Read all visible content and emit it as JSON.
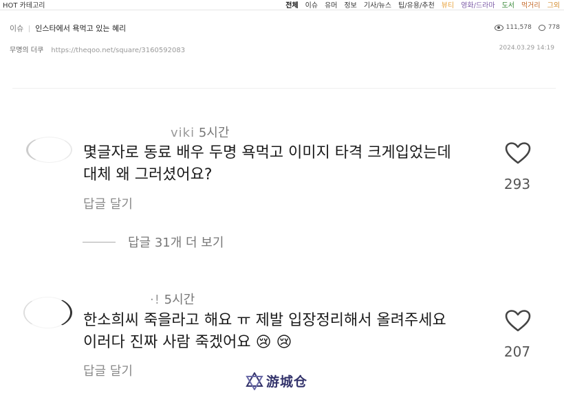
{
  "header": {
    "logo": "HOT 카테고리",
    "nav": [
      "전체",
      "이슈",
      "유머",
      "정보",
      "기사/뉴스",
      "팁/유용/추천",
      "뷰티",
      "영화/드라마",
      "도서",
      "먹거리",
      "그외"
    ],
    "active_nav": "전체"
  },
  "post": {
    "category": "이슈",
    "title": "인스타에서 욕먹고 있는 혜리",
    "views": "111,578",
    "comments": "778",
    "author": "무명의 더쿠",
    "url": "https://theqoo.net/square/3160592083",
    "date": "2024.03.29 14:19"
  },
  "comments": [
    {
      "handle": "viki",
      "time": "5시간",
      "lines": [
        "몇글자로 동료 배우 두명 욕먹고 이미지 타격 크게입었는데",
        "대체 왜 그러셨어요?"
      ],
      "reply_label": "답글 달기",
      "view_more": "답글 31개 더 보기",
      "likes": "293"
    },
    {
      "handle": "·!",
      "time": "5시간",
      "lines": [
        "한소희씨 죽을라고 해요 ㅠ 제발 입장정리해서 올려주세요",
        "이러다 진짜 사람 죽겠어요 😢 😢"
      ],
      "reply_label": "답글 달기",
      "likes": "207"
    }
  ],
  "watermark": "游城仓",
  "colors": {
    "watermark": "#33336b",
    "accent_nav": "#e8a33c"
  }
}
